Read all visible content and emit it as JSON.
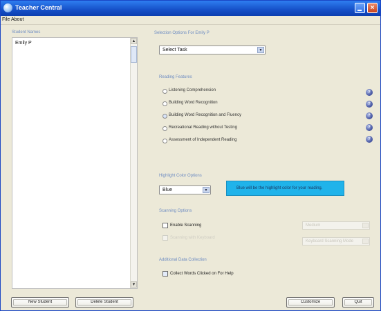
{
  "window": {
    "title": "Teacher Central"
  },
  "menu": [
    "File",
    "About"
  ],
  "students": {
    "header": "Student Names",
    "items": [
      "Emily P"
    ]
  },
  "selection": {
    "label": "Selection Options For Emily P",
    "task_value": "Select Task"
  },
  "reading": {
    "label": "Reading Features",
    "options": [
      {
        "label": "Listening Comprehension",
        "selected": false
      },
      {
        "label": "Building Word Recognition",
        "selected": false
      },
      {
        "label": "Building Word Recognition and Fluency",
        "selected": true
      },
      {
        "label": "Recreational Reading without Testing",
        "selected": false
      },
      {
        "label": "Assessment of Independent Reading",
        "selected": false
      }
    ],
    "help_icon": "question-icon"
  },
  "highlight": {
    "label": "Highlight Color Options",
    "value": "Blue",
    "banner_text": "Blue will be the highlight color for your reading.",
    "banner_color": "#20b3ea"
  },
  "scanning": {
    "label": "Scanning Options",
    "enable_label": "Enable Scanning",
    "enabled": false,
    "sub_option_label": "Scanning with Keyboard",
    "speed_value": "Medium",
    "mode_value": "Keyboard Scanning Mode"
  },
  "additional": {
    "label": "Additional Data Collection",
    "collect_label": "Collect Words Clicked on For Help",
    "collect_checked": true
  },
  "buttons": {
    "new_student": "New Student",
    "delete_student": "Delete Student",
    "customize": "Customize",
    "quit": "Quit"
  }
}
